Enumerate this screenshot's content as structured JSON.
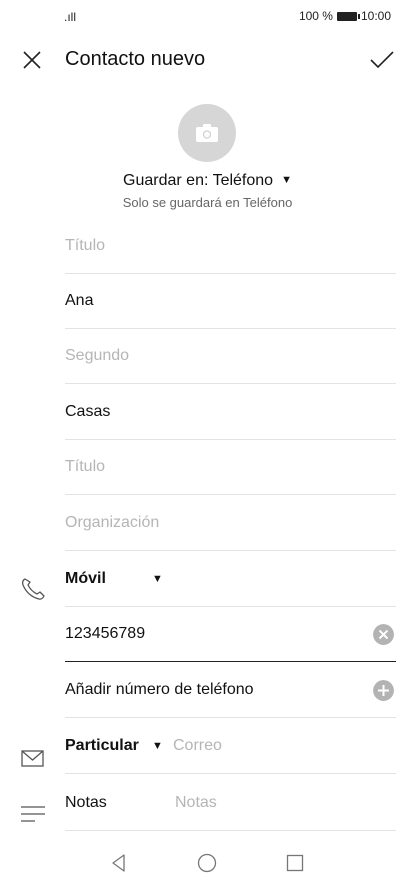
{
  "status_bar": {
    "signal": ".ıll",
    "battery": "100 %",
    "time": "10:00"
  },
  "app_bar": {
    "title": "Contacto nuevo"
  },
  "storage": {
    "label": "Guardar en: Teléfono",
    "note": "Solo se guardará en Teléfono"
  },
  "fields": {
    "prefix": "Título",
    "first_name": "Ana",
    "middle_name": "Segundo",
    "last_name": "Casas",
    "suffix": "Título",
    "organization": "Organización"
  },
  "phone": {
    "type": "Móvil",
    "number": "123456789",
    "add_label": "Añadir número de teléfono"
  },
  "email": {
    "type": "Particular",
    "placeholder": "Correo"
  },
  "notes": {
    "label": "Notas",
    "placeholder": "Notas"
  }
}
